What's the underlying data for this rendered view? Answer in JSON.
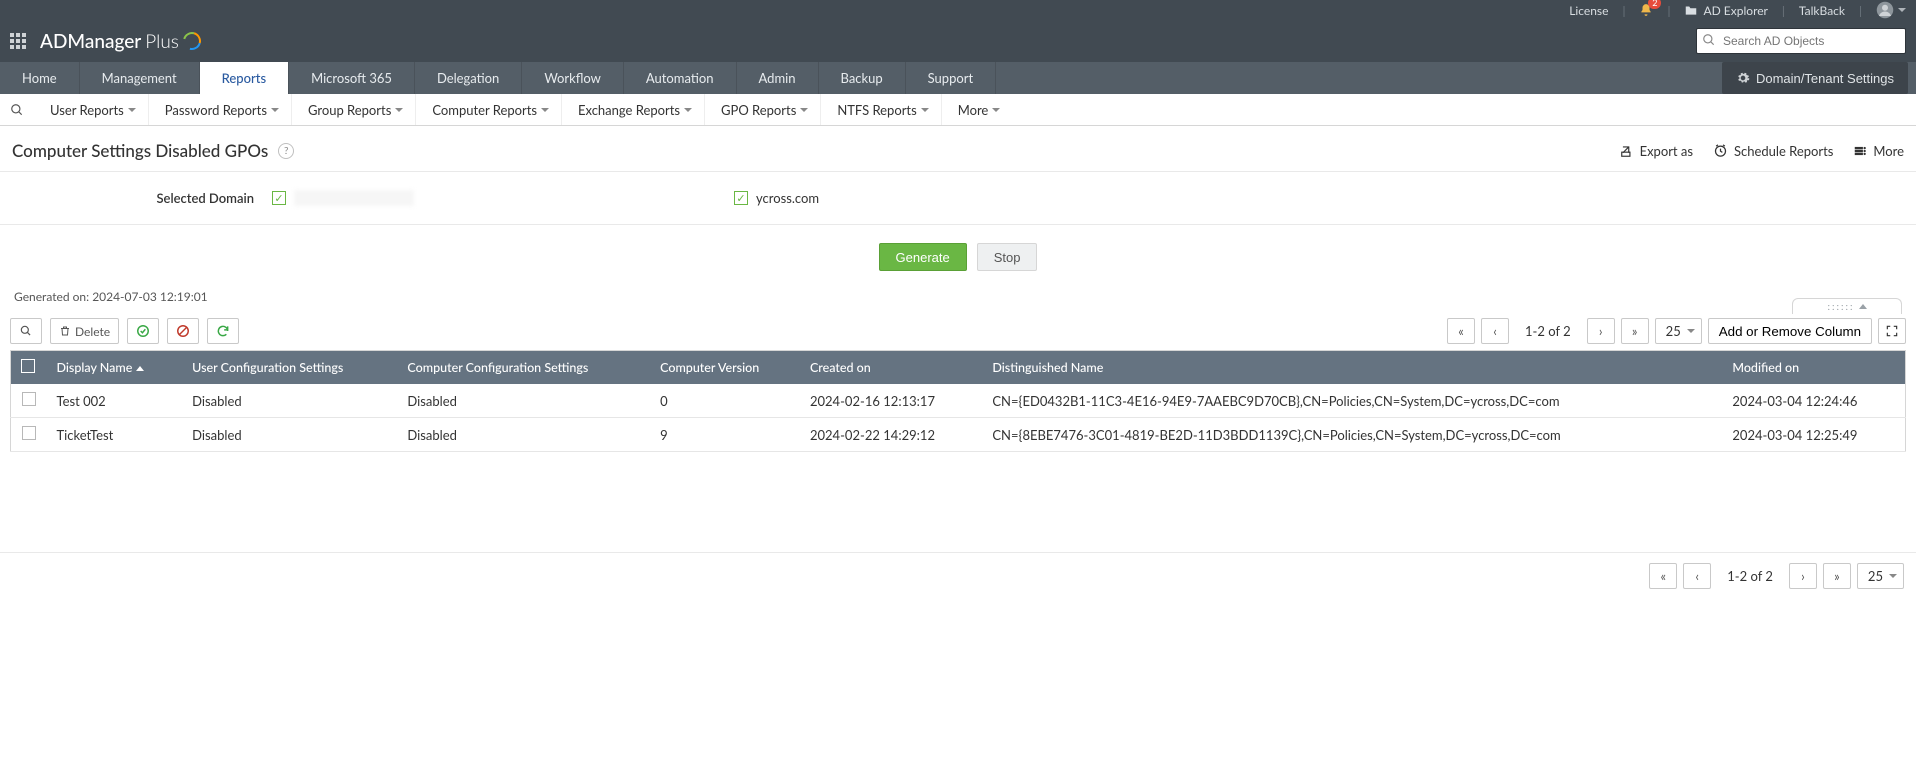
{
  "header": {
    "brand_bold": "ADManager",
    "brand_thin": "Plus",
    "license": "License",
    "notification_count": "2",
    "ad_explorer": "AD Explorer",
    "talkback": "TalkBack",
    "search_placeholder": "Search AD Objects",
    "domain_settings": "Domain/Tenant Settings"
  },
  "main_tabs": {
    "home": "Home",
    "management": "Management",
    "reports": "Reports",
    "microsoft365": "Microsoft 365",
    "delegation": "Delegation",
    "workflow": "Workflow",
    "automation": "Automation",
    "admin": "Admin",
    "backup": "Backup",
    "support": "Support"
  },
  "sub_tabs": {
    "user_reports": "User Reports",
    "password_reports": "Password Reports",
    "group_reports": "Group Reports",
    "computer_reports": "Computer Reports",
    "exchange_reports": "Exchange Reports",
    "gpo_reports": "GPO Reports",
    "ntfs_reports": "NTFS Reports",
    "more": "More"
  },
  "page": {
    "title": "Computer Settings Disabled GPOs",
    "export_as": "Export as",
    "schedule_reports": "Schedule Reports",
    "more": "More"
  },
  "domain": {
    "label": "Selected Domain",
    "d2": "ycross.com"
  },
  "buttons": {
    "generate": "Generate",
    "stop": "Stop"
  },
  "generated_on": "Generated on: 2024-07-03 12:19:01",
  "toolbar": {
    "delete": "Delete",
    "add_or_remove_column": "Add or Remove Column",
    "page_info": "1-2 of 2",
    "page_size": "25"
  },
  "columns": {
    "display_name": "Display Name",
    "user_cfg": "User Configuration Settings",
    "comp_cfg": "Computer Configuration Settings",
    "comp_ver": "Computer Version",
    "created_on": "Created on",
    "dn": "Distinguished Name",
    "modified_on": "Modified on"
  },
  "rows": [
    {
      "display_name": "Test 002",
      "user_cfg": "Disabled",
      "comp_cfg": "Disabled",
      "comp_ver": "0",
      "created_on": "2024-02-16 12:13:17",
      "dn": "CN={ED0432B1-11C3-4E16-94E9-7AAEBC9D70CB},CN=Policies,CN=System,DC=ycross,DC=com",
      "modified_on": "2024-03-04 12:24:46"
    },
    {
      "display_name": "TicketTest",
      "user_cfg": "Disabled",
      "comp_cfg": "Disabled",
      "comp_ver": "9",
      "created_on": "2024-02-22 14:29:12",
      "dn": "CN={8EBE7476-3C01-4819-BE2D-11D3BDD1139C},CN=Policies,CN=System,DC=ycross,DC=com",
      "modified_on": "2024-03-04 12:25:49"
    }
  ],
  "bottom": {
    "page_info": "1-2 of 2",
    "page_size": "25"
  }
}
